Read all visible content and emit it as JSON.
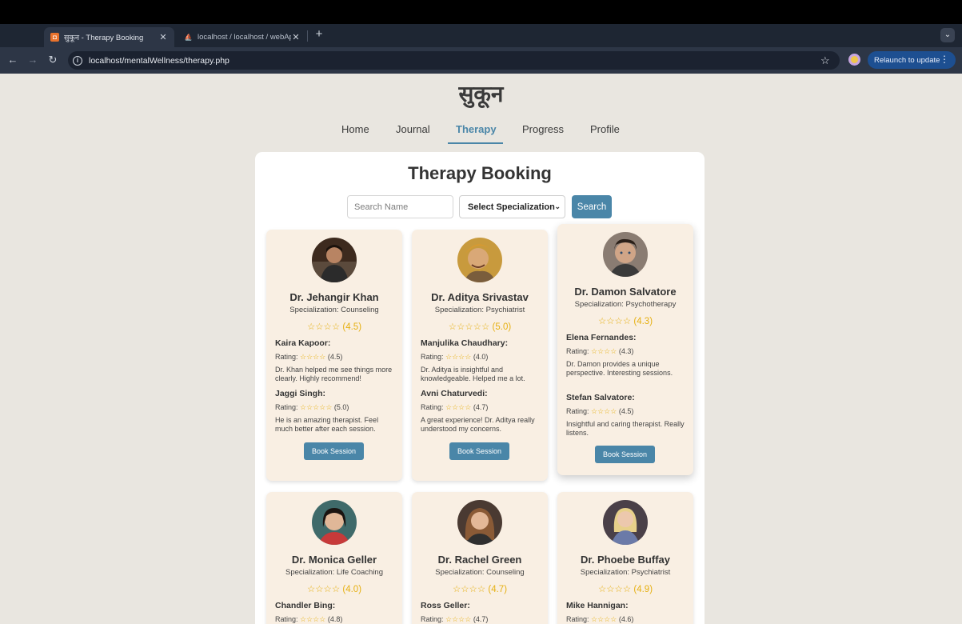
{
  "browser": {
    "tabs": [
      {
        "title": "सुकून - Therapy Booking",
        "favicon": "sukoon-favicon-icon",
        "active": true
      },
      {
        "title": "localhost / localhost / webApp",
        "favicon": "phpmyadmin-favicon-icon",
        "active": false
      }
    ],
    "new_tab_label": "+",
    "url": "localhost/mentalWellness/therapy.php",
    "relaunch_label": "Relaunch to update"
  },
  "site": {
    "logo": "सुकून",
    "nav": [
      "Home",
      "Journal",
      "Therapy",
      "Progress",
      "Profile"
    ],
    "active_nav": "Therapy"
  },
  "booking": {
    "title": "Therapy Booking",
    "search_placeholder": "Search Name",
    "select_label": "Select Specialization",
    "search_button": "Search",
    "book_label": "Book Session",
    "stars_full": "☆☆☆☆☆",
    "stars_four": "☆☆☆☆",
    "rating_prefix": "Rating:"
  },
  "therapists": [
    {
      "name": "Dr. Jehangir Khan",
      "specialization": "Specialization: Counseling",
      "stars": "☆☆☆☆",
      "rating": "(4.5)",
      "reviews": [
        {
          "name": "Kaira Kapoor:",
          "stars": "☆☆☆☆",
          "rating": "(4.5)",
          "text": "Dr. Khan helped me see things more clearly. Highly recommend!"
        },
        {
          "name": "Jaggi Singh:",
          "stars": "☆☆☆☆☆",
          "rating": "(5.0)",
          "text": "He is an amazing therapist. Feel much better after each session."
        }
      ]
    },
    {
      "name": "Dr. Aditya Srivastav",
      "specialization": "Specialization: Psychiatrist",
      "stars": "☆☆☆☆☆",
      "rating": "(5.0)",
      "reviews": [
        {
          "name": "Manjulika Chaudhary:",
          "stars": "☆☆☆☆",
          "rating": "(4.0)",
          "text": "Dr. Aditya is insightful and knowledgeable. Helped me a lot."
        },
        {
          "name": "Avni Chaturvedi:",
          "stars": "☆☆☆☆",
          "rating": "(4.7)",
          "text": "A great experience! Dr. Aditya really understood my concerns."
        }
      ]
    },
    {
      "name": "Dr. Damon Salvatore",
      "specialization": "Specialization: Psychotherapy",
      "stars": "☆☆☆☆",
      "rating": "(4.3)",
      "reviews": [
        {
          "name": "Elena Fernandes:",
          "stars": "☆☆☆☆",
          "rating": "(4.3)",
          "text": "Dr. Damon provides a unique perspective. Interesting sessions."
        },
        {
          "name": "Stefan Salvatore:",
          "stars": "☆☆☆☆",
          "rating": "(4.5)",
          "text": "Insightful and caring therapist. Really listens."
        }
      ]
    },
    {
      "name": "Dr. Monica Geller",
      "specialization": "Specialization: Life Coaching",
      "stars": "☆☆☆☆",
      "rating": "(4.0)",
      "reviews": [
        {
          "name": "Chandler Bing:",
          "stars": "☆☆☆☆",
          "rating": "(4.8)",
          "text": ""
        }
      ]
    },
    {
      "name": "Dr. Rachel Green",
      "specialization": "Specialization: Counseling",
      "stars": "☆☆☆☆",
      "rating": "(4.7)",
      "reviews": [
        {
          "name": "Ross Geller:",
          "stars": "☆☆☆☆",
          "rating": "(4.7)",
          "text": ""
        }
      ]
    },
    {
      "name": "Dr. Phoebe Buffay",
      "specialization": "Specialization: Psychiatrist",
      "stars": "☆☆☆☆",
      "rating": "(4.9)",
      "reviews": [
        {
          "name": "Mike Hannigan:",
          "stars": "☆☆☆☆",
          "rating": "(4.6)",
          "text": ""
        }
      ]
    }
  ],
  "colors": {
    "accent": "#4a86a8",
    "page_bg": "#e9e6e0",
    "card_bg": "#f9efe3",
    "star": "#e6b012"
  }
}
